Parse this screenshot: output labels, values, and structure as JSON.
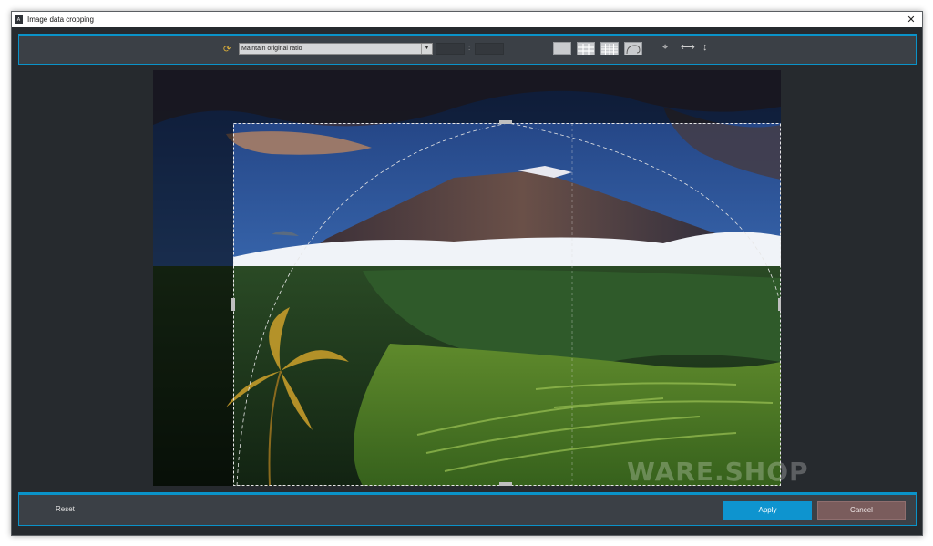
{
  "window": {
    "title": "Image data cropping",
    "close_glyph": "✕"
  },
  "toolbar": {
    "ratio_icon": "refresh-icon",
    "ratio_selected": "Maintain original ratio",
    "width_value": "",
    "height_value": "",
    "separator": ":",
    "grid_options": [
      "no-grid",
      "grid-3x3",
      "grid-4x4",
      "grid-golden"
    ],
    "tools": [
      "center-crosshair-icon",
      "horizontal-arrows-icon",
      "vertical-arrows-icon"
    ]
  },
  "watermark": "WARE.SHOP",
  "footer": {
    "reset_label": "Reset",
    "apply_label": "Apply",
    "cancel_label": "Cancel"
  },
  "colors": {
    "accent": "#0a93c9",
    "apply": "#0e94cf",
    "cancel": "#7a5c5c",
    "background": "#262a2e",
    "panel": "#3b4046"
  }
}
